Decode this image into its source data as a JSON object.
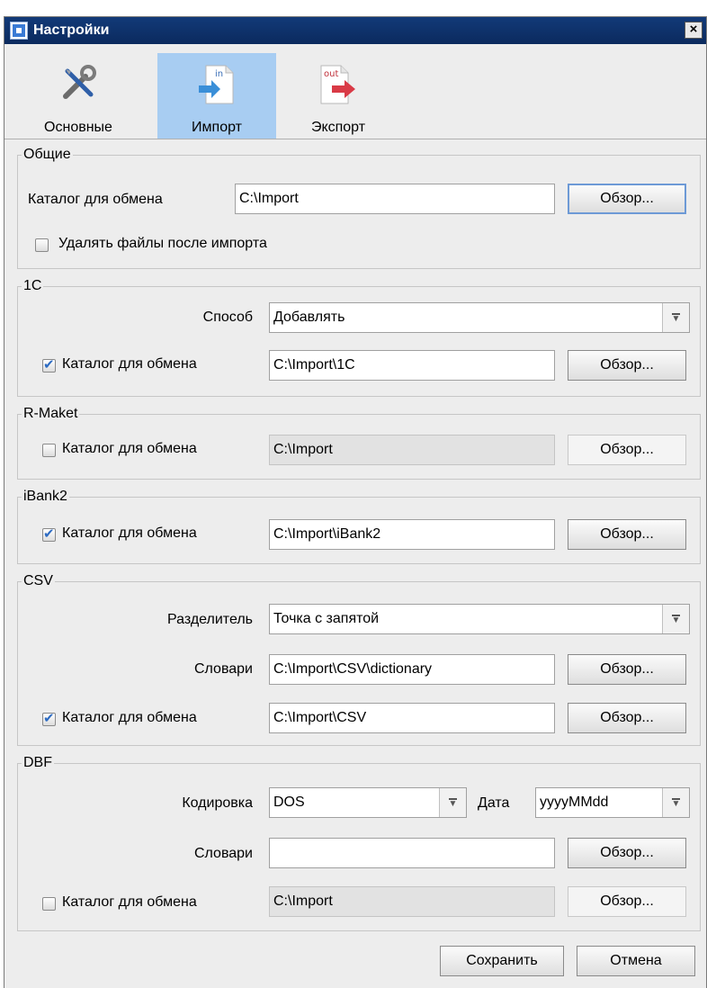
{
  "window": {
    "title": "Настройки",
    "close_label": "×"
  },
  "toolbar": {
    "tabs": [
      {
        "label": "Основные",
        "icon": "tools-icon",
        "active": false
      },
      {
        "label": "Импорт",
        "icon": "import-icon",
        "icon_text": "in",
        "active": true
      },
      {
        "label": "Экспорт",
        "icon": "export-icon",
        "icon_text": "out",
        "active": false
      }
    ]
  },
  "general": {
    "legend": "Общие",
    "dir_label": "Каталог для обмена",
    "dir_value": "C:\\Import",
    "browse_label": "Обзор...",
    "delete_label": "Удалять файлы после импорта",
    "delete_checked": false
  },
  "onec": {
    "legend": "1С",
    "method_label": "Способ",
    "method_value": "Добавлять",
    "dir_label": "Каталог для обмена",
    "dir_value": "C:\\Import\\1C",
    "dir_checked": true,
    "browse_label": "Обзор..."
  },
  "rmaket": {
    "legend": "R-Maket",
    "dir_label": "Каталог для обмена",
    "dir_value": "C:\\Import",
    "dir_checked": false,
    "browse_label": "Обзор..."
  },
  "ibank2": {
    "legend": "iBank2",
    "dir_label": "Каталог для обмена",
    "dir_value": "C:\\Import\\iBank2",
    "dir_checked": true,
    "browse_label": "Обзор..."
  },
  "csv": {
    "legend": "CSV",
    "separator_label": "Разделитель",
    "separator_value": "Точка с запятой",
    "dict_label": "Словари",
    "dict_value": "C:\\Import\\CSV\\dictionary",
    "dict_browse_label": "Обзор...",
    "dir_label": "Каталог для обмена",
    "dir_value": "C:\\Import\\CSV",
    "dir_checked": true,
    "browse_label": "Обзор..."
  },
  "dbf": {
    "legend": "DBF",
    "encoding_label": "Кодировка",
    "encoding_value": "DOS",
    "date_label": "Дата",
    "date_value": "yyyyMMdd",
    "dict_label": "Словари",
    "dict_value": "",
    "dict_browse_label": "Обзор...",
    "dir_label": "Каталог для обмена",
    "dir_value": "C:\\Import",
    "dir_checked": false,
    "browse_label": "Обзор..."
  },
  "footer": {
    "save_label": "Сохранить",
    "cancel_label": "Отмена"
  },
  "colors": {
    "titlebar": "#0b2a5e",
    "active_tab": "#a8cdf2",
    "check": "#2d6bc2"
  }
}
